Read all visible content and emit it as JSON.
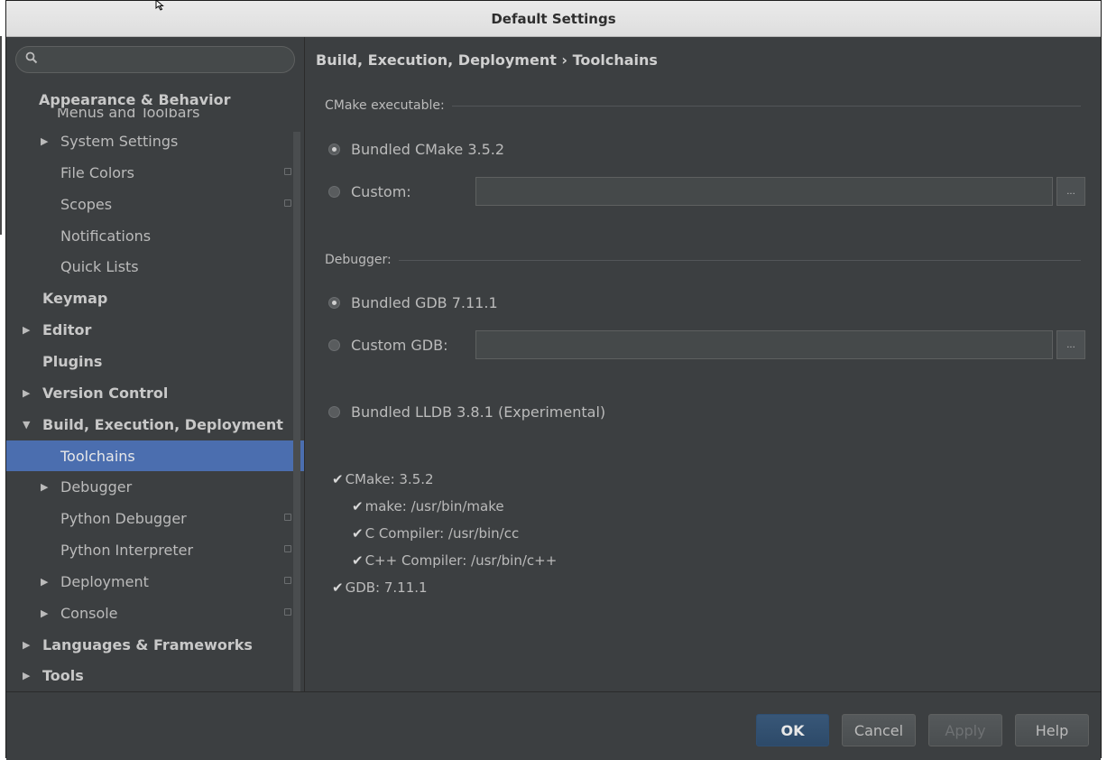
{
  "window": {
    "title": "Default Settings"
  },
  "search": {
    "placeholder": ""
  },
  "sidebar": {
    "header_top": "Appearance & Behavior",
    "header_cut": "Menus and Toolbars",
    "items": [
      {
        "label": "System Settings",
        "arrow": "▶",
        "copy": false
      },
      {
        "label": "File Colors",
        "arrow": "",
        "copy": true
      },
      {
        "label": "Scopes",
        "arrow": "",
        "copy": true
      },
      {
        "label": "Notifications",
        "arrow": "",
        "copy": false
      },
      {
        "label": "Quick Lists",
        "arrow": "",
        "copy": false
      },
      {
        "label": "Keymap",
        "arrow": "",
        "copy": false
      },
      {
        "label": "Editor",
        "arrow": "▶",
        "copy": false
      },
      {
        "label": "Plugins",
        "arrow": "",
        "copy": false
      },
      {
        "label": "Version Control",
        "arrow": "▶",
        "copy": false
      },
      {
        "label": "Build, Execution, Deployment",
        "arrow": "▼",
        "copy": false
      },
      {
        "label": "Toolchains",
        "arrow": "",
        "copy": false,
        "selected": true
      },
      {
        "label": "Debugger",
        "arrow": "▶",
        "copy": false
      },
      {
        "label": "Python Debugger",
        "arrow": "",
        "copy": true
      },
      {
        "label": "Python Interpreter",
        "arrow": "",
        "copy": true
      },
      {
        "label": "Deployment",
        "arrow": "▶",
        "copy": true
      },
      {
        "label": "Console",
        "arrow": "▶",
        "copy": true
      },
      {
        "label": "Languages & Frameworks",
        "arrow": "▶",
        "copy": false
      },
      {
        "label": "Tools",
        "arrow": "▶",
        "copy": false
      }
    ]
  },
  "main": {
    "breadcrumb": "Build, Execution, Deployment › Toolchains",
    "cmake_section": "CMake executable:",
    "cmake_bundled": "Bundled CMake 3.5.2",
    "cmake_custom": "Custom:",
    "cmake_custom_value": "",
    "debugger_section": "Debugger:",
    "gdb_bundled": "Bundled GDB 7.11.1",
    "gdb_custom": "Custom GDB:",
    "gdb_custom_value": "",
    "lldb_bundled": "Bundled LLDB 3.8.1 (Experimental)",
    "browse_label": "...",
    "checks": {
      "cmake": "CMake: 3.5.2",
      "make": "make: /usr/bin/make",
      "c_compiler": "C Compiler: /usr/bin/cc",
      "cpp_compiler": "C++ Compiler: /usr/bin/c++",
      "gdb": "GDB: 7.11.1"
    }
  },
  "buttons": {
    "ok": "OK",
    "cancel": "Cancel",
    "apply": "Apply",
    "help": "Help"
  },
  "colors": {
    "selection": "#4b6eaf",
    "background": "#3c3f41",
    "primary_button": "#385778"
  }
}
